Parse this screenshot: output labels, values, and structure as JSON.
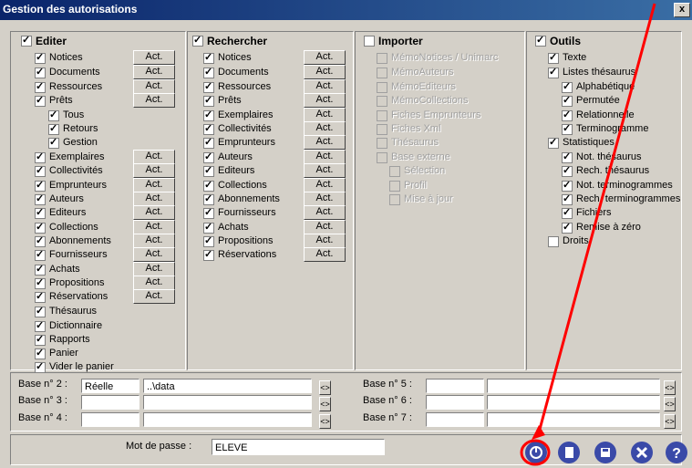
{
  "window": {
    "title": "Gestion des autorisations",
    "close_label": "x"
  },
  "editer": {
    "header": "Editer",
    "items": [
      "Notices",
      "Documents",
      "Ressources",
      "Prêts",
      "Tous",
      "Retours",
      "Gestion",
      "Exemplaires",
      "Collectivités",
      "Emprunteurs",
      "Auteurs",
      "Editeurs",
      "Collections",
      "Abonnements",
      "Fournisseurs",
      "Achats",
      "Propositions",
      "Réservations",
      "Thésaurus",
      "Dictionnaire",
      "Rapports",
      "Panier",
      "Vider le panier"
    ]
  },
  "rechercher": {
    "header": "Rechercher",
    "items": [
      "Notices",
      "Documents",
      "Ressources",
      "Prêts",
      "Exemplaires",
      "Collectivités",
      "Emprunteurs",
      "Auteurs",
      "Editeurs",
      "Collections",
      "Abonnements",
      "Fournisseurs",
      "Achats",
      "Propositions",
      "Réservations"
    ]
  },
  "importer": {
    "header": "Importer",
    "items": [
      "MémoNotices / Unimarc",
      "MémoAuteurs",
      "MémoEditeurs",
      "MémoCollections",
      "Fiches Emprunteurs",
      "Fiches Xml",
      "Thésaurus",
      "Base externe",
      "Sélection",
      "Profil",
      "Mise à jour"
    ]
  },
  "outils": {
    "header": "Outils",
    "items": [
      "Texte",
      "Listes thésaurus",
      "Alphabétique",
      "Permutée",
      "Relationnelle",
      "Terminogramme",
      "Statistiques",
      "Not. thésaurus",
      "Rech. thésaurus",
      "Not. terminogrammes",
      "Rech. terminogrammes",
      "Fichiers",
      "Remise à zéro",
      "Droits"
    ]
  },
  "act_label": "Act.",
  "bases": {
    "b2": {
      "label": "Base n° 2 :",
      "type": "Réelle",
      "path": "..\\data"
    },
    "b3": {
      "label": "Base n° 3 :"
    },
    "b4": {
      "label": "Base n° 4 :"
    },
    "b5": {
      "label": "Base n° 5 :"
    },
    "b6": {
      "label": "Base n° 6 :"
    },
    "b7": {
      "label": "Base n° 7 :"
    },
    "arrow_glyph": "<>"
  },
  "password": {
    "label": "Mot de passe :",
    "value": "ELEVE"
  },
  "toolbar_icons": [
    "power-icon",
    "notebook-icon",
    "save-icon",
    "cancel-icon",
    "help-icon"
  ],
  "colors": {
    "title_start": "#0a246a",
    "title_end": "#3a6ea5",
    "icon_blue": "#3a4aa8",
    "annotation_red": "#ff0000"
  }
}
